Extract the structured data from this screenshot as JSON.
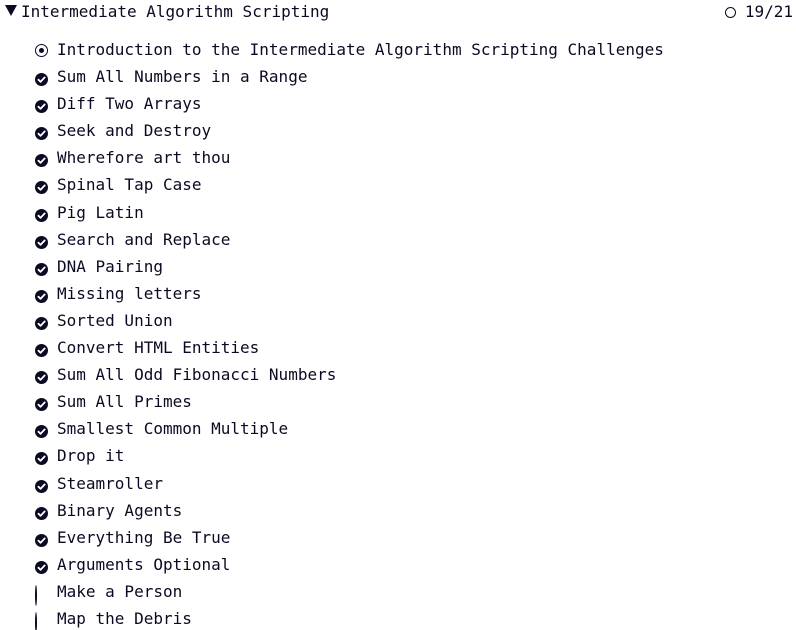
{
  "section": {
    "title": "Intermediate Algorithm Scripting",
    "progress_text": "19/21",
    "expanded": true
  },
  "challenges": [
    {
      "label": "Introduction to the Intermediate Algorithm Scripting Challenges",
      "status": "current"
    },
    {
      "label": "Sum All Numbers in a Range",
      "status": "completed"
    },
    {
      "label": "Diff Two Arrays",
      "status": "completed"
    },
    {
      "label": "Seek and Destroy",
      "status": "completed"
    },
    {
      "label": "Wherefore art thou",
      "status": "completed"
    },
    {
      "label": "Spinal Tap Case",
      "status": "completed"
    },
    {
      "label": "Pig Latin",
      "status": "completed"
    },
    {
      "label": "Search and Replace",
      "status": "completed"
    },
    {
      "label": "DNA Pairing",
      "status": "completed"
    },
    {
      "label": "Missing letters",
      "status": "completed"
    },
    {
      "label": "Sorted Union",
      "status": "completed"
    },
    {
      "label": "Convert HTML Entities",
      "status": "completed"
    },
    {
      "label": "Sum All Odd Fibonacci Numbers",
      "status": "completed"
    },
    {
      "label": "Sum All Primes",
      "status": "completed"
    },
    {
      "label": "Smallest Common Multiple",
      "status": "completed"
    },
    {
      "label": "Drop it",
      "status": "completed"
    },
    {
      "label": "Steamroller",
      "status": "completed"
    },
    {
      "label": "Binary Agents",
      "status": "completed"
    },
    {
      "label": "Everything Be True",
      "status": "completed"
    },
    {
      "label": "Arguments Optional",
      "status": "completed"
    },
    {
      "label": "Make a Person",
      "status": "incomplete"
    },
    {
      "label": "Map the Debris",
      "status": "incomplete"
    }
  ],
  "colors": {
    "text": "#0a0a23",
    "background": "#ffffff"
  },
  "icons": {
    "completed": "check-circle-icon",
    "current": "current-dot-icon",
    "incomplete": "empty-circle-icon",
    "expand": "caret-down-icon"
  }
}
